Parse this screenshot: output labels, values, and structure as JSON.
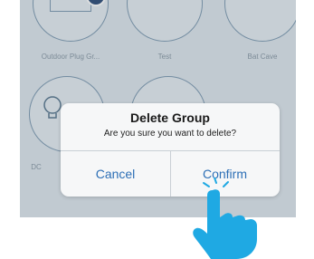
{
  "tiles": [
    {
      "label": "Outdoor Plug Gr...",
      "icon": "plug-icon",
      "selected": true
    },
    {
      "label": "Test",
      "icon": "bulb-icon"
    },
    {
      "label": "Bat Cave",
      "icon": "bulb-icon"
    },
    {
      "label": "DC",
      "icon": "bulb-icon"
    },
    {
      "label": "",
      "icon": "bulb-icon"
    }
  ],
  "dialog": {
    "title": "Delete Group",
    "message": "Are you sure you want to delete?",
    "cancel_label": "Cancel",
    "confirm_label": "Confirm"
  },
  "colors": {
    "accent": "#2d6fb6",
    "tile_border": "#7f9cb4",
    "hand": "#1fa9e3"
  }
}
